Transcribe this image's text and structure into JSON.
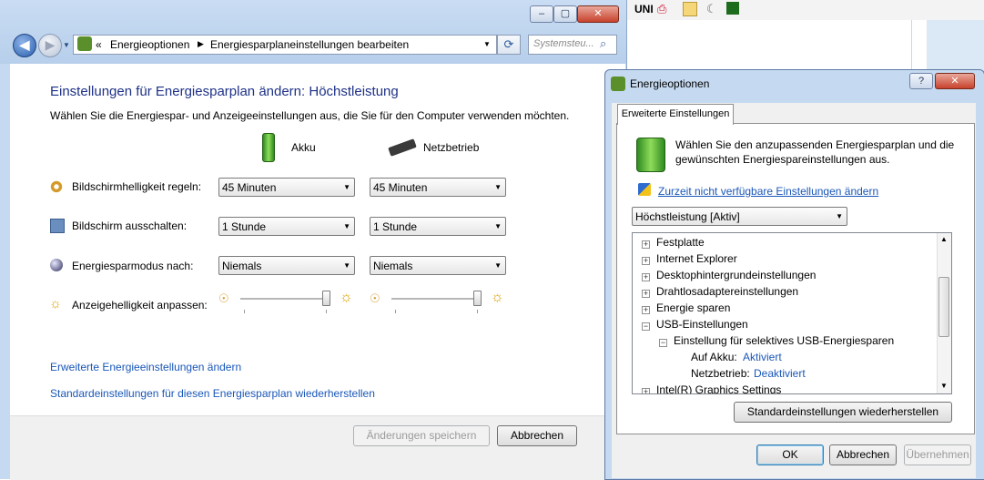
{
  "taskbar": {
    "uni_label": "UNI"
  },
  "main_window": {
    "breadcrumb": {
      "chevron": "«",
      "items": [
        "Energieoptionen",
        "Energiesparplaneinstellungen bearbeiten"
      ]
    },
    "search_placeholder": "Systemsteu...",
    "title": "Einstellungen für Energiesparplan ändern: Höchstleistung",
    "subtitle": "Wählen Sie die Energiespar- und Anzeigeeinstellungen aus, die Sie für den Computer verwenden möchten.",
    "columns": {
      "battery": "Akku",
      "plugged": "Netzbetrieb"
    },
    "settings": [
      {
        "label": "Bildschirmhelligkeit regeln:",
        "battery": "45 Minuten",
        "plugged": "45 Minuten"
      },
      {
        "label": "Bildschirm ausschalten:",
        "battery": "1 Stunde",
        "plugged": "1 Stunde"
      },
      {
        "label": "Energiesparmodus nach:",
        "battery": "Niemals",
        "plugged": "Niemals"
      }
    ],
    "brightness": {
      "label": "Anzeigehelligkeit anpassen:",
      "battery_level": 1.0,
      "plugged_level": 1.0
    },
    "links": {
      "advanced": "Erweiterte Energieeinstellungen ändern",
      "restore": "Standardeinstellungen für diesen Energiesparplan wiederherstellen"
    },
    "buttons": {
      "save": "Änderungen speichern",
      "cancel": "Abbrechen"
    }
  },
  "dialog": {
    "title": "Energieoptionen",
    "help": "?",
    "close": "✕",
    "tab": "Erweiterte Einstellungen",
    "description": "Wählen Sie den anzupassenden Energiesparplan und die gewünschten Energiespareinstellungen aus.",
    "link": "Zurzeit nicht verfügbare Einstellungen ändern",
    "plan": "Höchstleistung [Aktiv]",
    "tree": [
      {
        "label": "Festplatte",
        "sign": "+"
      },
      {
        "label": "Internet Explorer",
        "sign": "+"
      },
      {
        "label": "Desktophintergrundeinstellungen",
        "sign": "+"
      },
      {
        "label": "Drahtlosadaptereinstellungen",
        "sign": "+"
      },
      {
        "label": "Energie sparen",
        "sign": "+"
      },
      {
        "label": "USB-Einstellungen",
        "sign": "−"
      },
      {
        "label": "Einstellung für selektives USB-Energiesparen",
        "sign": "−"
      },
      {
        "label": "Auf Akku:",
        "value": "Aktiviert"
      },
      {
        "label": "Netzbetrieb:",
        "value": "Deaktiviert"
      },
      {
        "label": "Intel(R) Graphics Settings",
        "sign": "+"
      }
    ],
    "restore_button": "Standardeinstellungen wiederherstellen",
    "buttons": {
      "ok": "OK",
      "cancel": "Abbrechen",
      "apply": "Übernehmen"
    }
  }
}
